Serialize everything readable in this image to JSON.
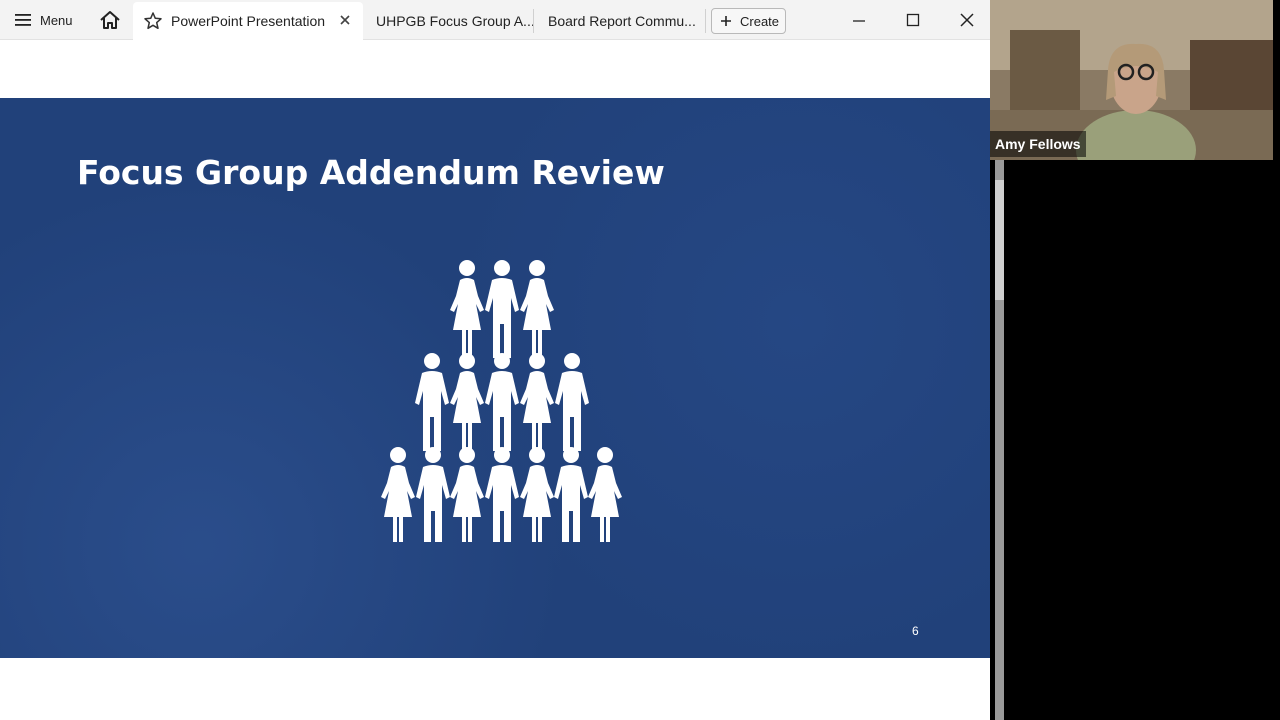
{
  "window": {
    "menu_label": "Menu",
    "tabs": [
      {
        "label": "PowerPoint Presentation",
        "active": true
      },
      {
        "label": "UHPGB Focus Group A...",
        "active": false
      },
      {
        "label": "Board Report Commu...",
        "active": false
      }
    ],
    "create_label": "Create"
  },
  "slide": {
    "title": "Focus Group Addendum Review",
    "number": "6",
    "graphic": "people-pyramid"
  },
  "video": {
    "participant_name": "Amy Fellows"
  },
  "colors": {
    "slide_background": "#21417a",
    "tab_bar": "#f3f3f3",
    "graphic": "#ffffff"
  }
}
